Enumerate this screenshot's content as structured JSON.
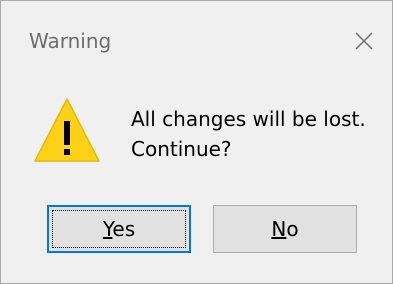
{
  "window": {
    "title": "Warning"
  },
  "icons": {
    "close": "close-icon",
    "warning": "warning-icon"
  },
  "message": {
    "line1": "All changes will be lost.",
    "line2": "Continue?"
  },
  "buttons": {
    "yes": {
      "mnemonic": "Y",
      "rest": "es"
    },
    "no": {
      "mnemonic": "N",
      "rest": "o"
    }
  },
  "colors": {
    "warning_fill": "#fcd116",
    "focus_border": "#0078d7",
    "button_face": "#e1e1e1"
  }
}
